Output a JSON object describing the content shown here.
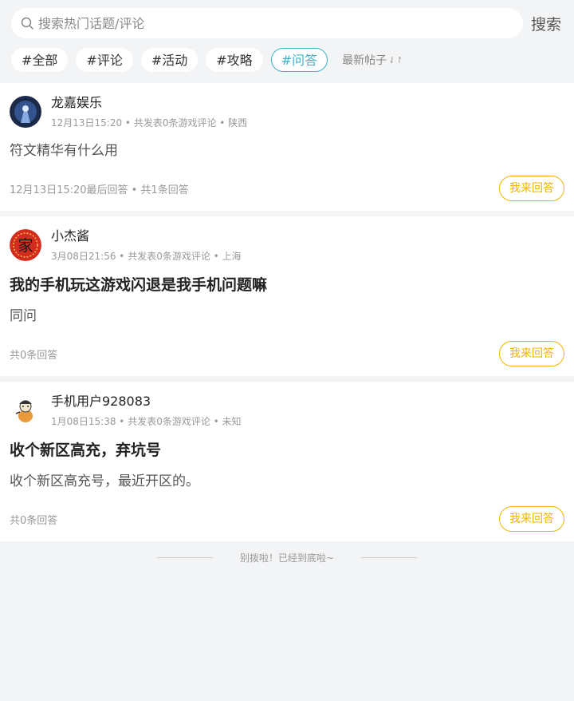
{
  "search": {
    "placeholder": "搜索热门话题/评论",
    "button_label": "搜索"
  },
  "tabs": [
    {
      "label": "#全部",
      "active": false
    },
    {
      "label": "#评论",
      "active": false
    },
    {
      "label": "#活动",
      "active": false
    },
    {
      "label": "#攻略",
      "active": false
    },
    {
      "label": "#问答",
      "active": true
    }
  ],
  "sort": {
    "label": "最新帖子",
    "icon": "sort-arrows-icon"
  },
  "posts": [
    {
      "user": "龙嘉娱乐",
      "meta": "12月13日15:20 • 共发表0条游戏评论 • 陕西",
      "title": "",
      "body": "符文精华有什么用",
      "answers": "12月13日15:20最后回答 • 共1条回答",
      "answer_button": "我来回答"
    },
    {
      "user": "小杰酱",
      "meta": "3月08日21:56 • 共发表0条游戏评论 • 上海",
      "title": "我的手机玩这游戏闪退是我手机问题嘛",
      "body": "同问",
      "answers": "共0条回答",
      "answer_button": "我来回答"
    },
    {
      "user": "手机用户928083",
      "meta": "1月08日15:38 • 共发表0条游戏评论 • 未知",
      "title": "收个新区高充，弃坑号",
      "body": "收个新区高充号，最近开区的。",
      "answers": "共0条回答",
      "answer_button": "我来回答"
    }
  ],
  "footer": {
    "end_text": "别拨啦！已经到底啦~"
  },
  "colors": {
    "accent": "#3fb1c6",
    "answer": "#f0b400",
    "background": "#f3f4f6"
  }
}
